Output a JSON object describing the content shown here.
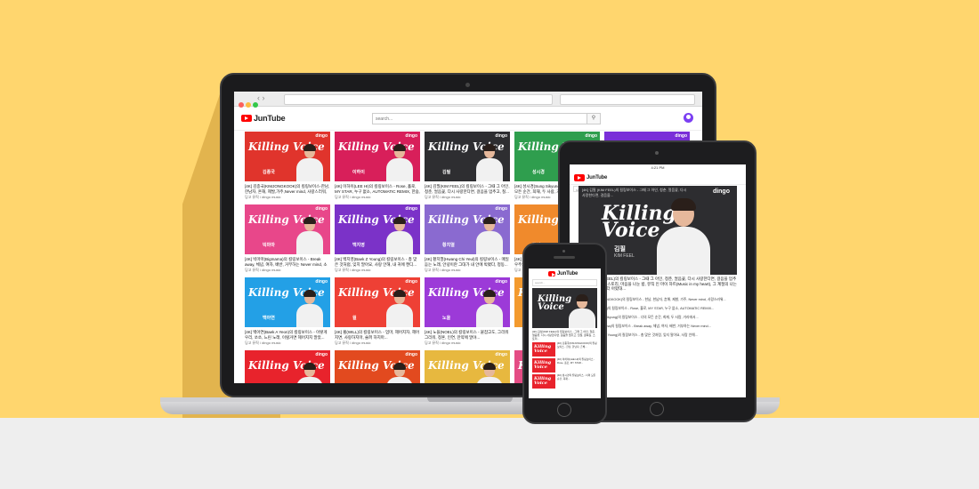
{
  "colors": {
    "background_top": "#FFD66E",
    "background_bottom": "#EEEEEE",
    "brand_red": "#FF0000"
  },
  "app": {
    "name": "JunTube"
  },
  "search": {
    "placeholder": "search..."
  },
  "icons": {
    "search": "search-icon",
    "account": "account-icon"
  },
  "laptop": {
    "videos": [
      {
        "title": "[4K] 김종국(KIMJONGKOOK)의 킬링보이스-한남, 한남자, 흔해, 제발,가주,Never mind, 사랑스러워, 편지, 고...",
        "channel": "딩고 뮤직 / dingo music",
        "singer": "김종국",
        "bg": "#e0342c"
      },
      {
        "title": "[4K] 이하이(LEE HI)의 킬링보이스 - Rose, 홀로, MY STAR, 누구 없소, AUTOMATIC REMIX, 한숨, 아이고...",
        "channel": "딩고 뮤직 / dingo music",
        "singer": "이하이",
        "bg": "#d81f5a"
      },
      {
        "title": "[4K] 김필(KIM FEEL)의 킬링보이스 - 그때 그 아인, 청춘, 얼음꽃, 다시 사랑한다면, 걸음을 멈추고, 칠...",
        "channel": "딩고 뮤직 / dingo music",
        "singer": "김필",
        "bg": "#2e2e31"
      },
      {
        "title": "[4K] 성시경(Sung Sikyung)의 킬링보이스 - 너의 모든 순간, 희재, 두 사람, 거리에서...",
        "channel": "딩고 뮤직 / dingo music",
        "singer": "성시경",
        "bg": "#2f9e4e"
      },
      {
        "title": "",
        "channel": "",
        "singer": "",
        "bg": "#7a2fd8"
      },
      {
        "title": "[4K] 빅마마(Bigmama)의 킬링보이스 - Break away, 체념, 여자, 배반, 거부하는 Never mind, 소리쳐, 고...",
        "channel": "딩고 뮤직 / dingo music",
        "singer": "빅마마",
        "bg": "#e8478a"
      },
      {
        "title": "[4K] 백지영(Baek Z Young)의 킬링보이스 - 총 맞은 것처럼, 잊지 말아요, 사랑 안해, 내 귀에 캔디...",
        "channel": "딩고 뮤직 / dingo music",
        "singer": "백지영",
        "bg": "#7b32c8"
      },
      {
        "title": "[4K] 황치열(Hwang Chi Yeul)의 킬링보이스 - 매일 듣는 노래, 안녕이란 그대가 내 안에 박혔다, 정동...",
        "channel": "딩고 뮤직 / dingo music",
        "singer": "황치열",
        "bg": "#8a6ad0"
      },
      {
        "title": "[4K] 조이(JOY)의 킬링보이스 - 안녕, 좋을텐데, 호우주의보...",
        "channel": "딩고 뮤직 / dingo music",
        "singer": "조이",
        "bg": "#f08a2c"
      },
      {
        "title": "",
        "channel": "",
        "singer": "",
        "bg": "#dadada"
      },
      {
        "title": "[4K] 백아연(Baek A Yeon)의 킬링보이스 - 이렇게 우리, 쏘쏘, 느린 노래, 이럴거면 헤어지지 말았...",
        "channel": "딩고 뮤직 / dingo music",
        "singer": "백아연",
        "bg": "#23a0e6"
      },
      {
        "title": "[4K] 윌(WILL)의 킬링보이스 - 엄마, 헤어지자, 헤어지면, 사랑하지마, 슬퍼 하지마...",
        "channel": "딩고 뮤직 / dingo music",
        "singer": "윌",
        "bg": "#ee4035"
      },
      {
        "title": "[4K] 노을(NOEL)의 킬링보이스 - 붙잡고도, 그리워 그리워, 청혼, 인연, 만약에 말야...",
        "channel": "딩고 뮤직 / dingo music",
        "singer": "노을",
        "bg": "#9c3ad8"
      },
      {
        "title": "",
        "channel": "",
        "singer": "",
        "bg": "#f39a2e"
      },
      {
        "title": "",
        "channel": "",
        "singer": "",
        "bg": "#1e63d6"
      },
      {
        "title": "",
        "channel": "",
        "singer": "DM Killing Voice",
        "bg": "#e8232c"
      },
      {
        "title": "",
        "channel": "",
        "singer": "",
        "bg": "#e24a1f"
      },
      {
        "title": "",
        "channel": "",
        "singer": "",
        "bg": "#e7b83f"
      },
      {
        "title": "",
        "channel": "",
        "singer": "",
        "bg": "#e44c84"
      },
      {
        "title": "",
        "channel": "",
        "singer": "",
        "bg": "#2a2a2a"
      }
    ],
    "thumb_brand": "Killing Voice",
    "badge": "dingo"
  },
  "tablet": {
    "status_time": "4:21 PM",
    "hero_caption": "[4K] 김필 (KIM FEEL)의 킬링보이스 - 그때 그 아인, 청춘, 얼음꽃, 다시 사랑한다면, 걸음을...",
    "hero_name": "김필",
    "hero_sub": "KIM FEEL",
    "title": "[4K] 김필(KIM FEEL)의 킬링보이스 - 그때 그 아인, 청춘, 얼음꽃, 다시 사랑한다면, 걸음을 멈추고, 칠월, 골목길, 스토리, 마음을 나눈 밤, 뮤직 인 마이 하트(Music in my heart), 그 계절의 나는 생각보다 우리가 더 아팠대...",
    "list": [
      "[4K] 김종국(KIMJONGKOOK)의 킬링보이스 - 한남, 한남자, 흔해, 제발, 가주, Never mind, 사랑스러워...",
      "[4K] 이하이(LEE HI)의 킬링보이스 - Rose, 홀로, MY STAR, 누구 없소, AUTOMATIC REMIX...",
      "[4K] 성시경(Sung Sikyung)의 킬링보이스 - 너의 모든 순간, 희재, 두 사람, 거리에서...",
      "[4K] 빅마마(Bigmama)의 킬링보이스 - Break away, 체념, 여자, 배반, 거부하는 Never mind...",
      "[4K] 백지영(Baek Z Young)의 킬링보이스 - 총 맞은 것처럼, 잊지 말아요, 사랑 안해..."
    ]
  },
  "phone": {
    "hero_text": "[4K] 김필(KIM FEEL)의 킬링보이스 - 그때 그 아인, 청춘, 얼음꽃, 다시 사랑한다면, 걸음을 멈추고, 칠월, 골목길, 스토리...",
    "items": [
      "[4K] 김종국(KIMJONGKOOK)의 킬링보이스 - 한남, 한남자, 흔해...",
      "[4K] 이하이(LEE HI)의 킬링보이스 - Rose, 홀로, MY STAR...",
      "[4K] 성시경의 킬링보이스 - 너의 모든 순간, 희재..."
    ]
  }
}
